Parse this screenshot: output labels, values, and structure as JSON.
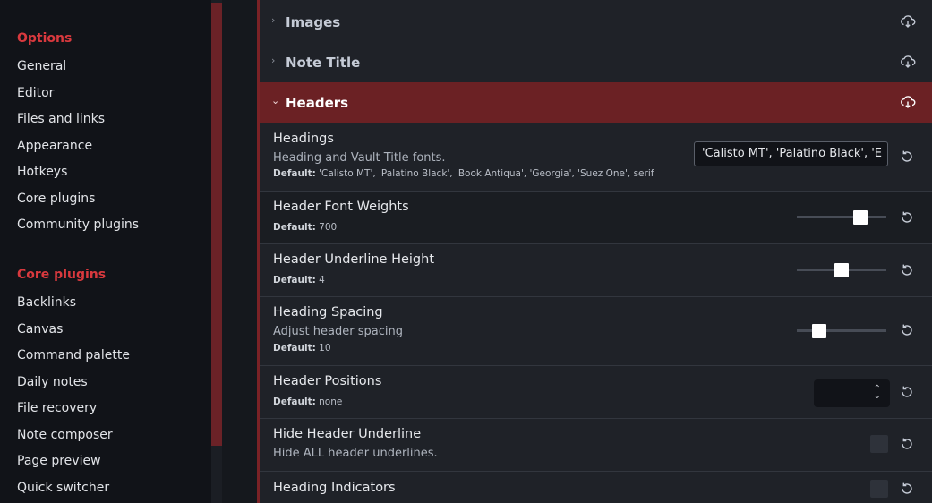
{
  "sidebar": {
    "options_heading": "Options",
    "options_items": [
      "General",
      "Editor",
      "Files and links",
      "Appearance",
      "Hotkeys",
      "Core plugins",
      "Community plugins"
    ],
    "core_heading": "Core plugins",
    "core_items": [
      "Backlinks",
      "Canvas",
      "Command palette",
      "Daily notes",
      "File recovery",
      "Note composer",
      "Page preview",
      "Quick switcher"
    ]
  },
  "sections": {
    "images": "Images",
    "note_title": "Note Title",
    "headers": "Headers"
  },
  "settings": {
    "headings": {
      "title": "Headings",
      "desc": "Heading and Vault Title fonts.",
      "default_label": "Default:",
      "default_value": "'Calisto MT', 'Palatino Black', 'Book Antiqua', 'Georgia', 'Suez One', serif",
      "input_value": "'Calisto MT', 'Palatino Black', 'E"
    },
    "font_weights": {
      "title": "Header Font Weights",
      "default_label": "Default:",
      "default_value": "700",
      "slider_fraction": 0.71
    },
    "underline_height": {
      "title": "Header Underline Height",
      "default_label": "Default:",
      "default_value": "4",
      "slider_fraction": 0.5
    },
    "heading_spacing": {
      "title": "Heading Spacing",
      "desc": "Adjust header spacing",
      "default_label": "Default:",
      "default_value": "10",
      "slider_fraction": 0.25
    },
    "header_positions": {
      "title": "Header Positions",
      "default_label": "Default:",
      "default_value": "none",
      "select_value": ""
    },
    "hide_underline": {
      "title": "Hide Header Underline",
      "desc": "Hide ALL header underlines.",
      "checked": false
    },
    "heading_indicators": {
      "title": "Heading Indicators",
      "checked": false
    }
  },
  "colors": {
    "accent": "#d9393e",
    "section_open_bg": "#6b2124"
  },
  "icons": {
    "section": "cloud-download-icon",
    "reset": "reset-icon",
    "chevron_collapsed": "chevron-right-icon",
    "chevron_expanded": "chevron-down-icon"
  }
}
